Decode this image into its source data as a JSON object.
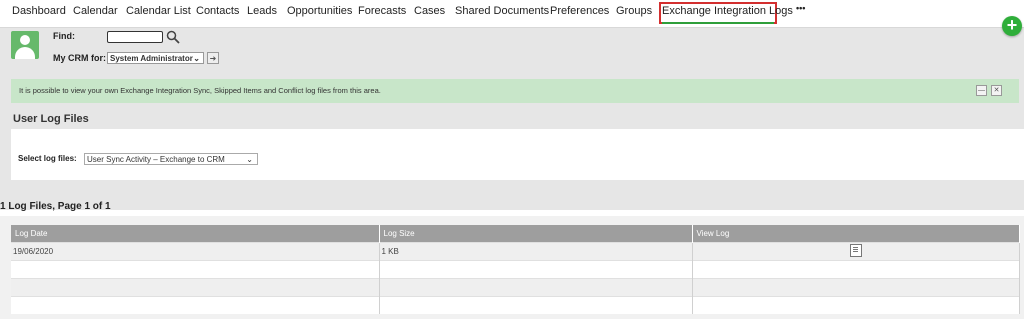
{
  "nav": {
    "tabs": [
      {
        "label": "Dashboard"
      },
      {
        "label": "Calendar"
      },
      {
        "label": "Calendar List"
      },
      {
        "label": "Contacts"
      },
      {
        "label": "Leads"
      },
      {
        "label": "Opportunities"
      },
      {
        "label": "Forecasts"
      },
      {
        "label": "Cases"
      },
      {
        "label": "Shared Documents"
      },
      {
        "label": "Preferences"
      },
      {
        "label": "Groups"
      },
      {
        "label": "Exchange Integration Logs"
      }
    ],
    "more": "•••",
    "active_tab": "Exchange Integration Logs",
    "add_label": "+"
  },
  "header": {
    "find_label": "Find:",
    "find_value": "",
    "crm_label": "My CRM for:",
    "crm_value": "System Administrator",
    "go_icon": "arrow-right-icon",
    "search_icon": "search-icon",
    "avatar_icon": "user-icon"
  },
  "banner": {
    "text": "It is possible to view your own Exchange Integration Sync, Skipped Items and Conflict log files from this area.",
    "color": "#c8e6c9"
  },
  "user_log_files": {
    "title": "User Log Files",
    "select_label": "Select log files:",
    "select_value": "User Sync Activity – Exchange to CRM"
  },
  "results": {
    "page_info": "1 Log Files, Page 1 of 1",
    "columns": [
      "Log Date",
      "Log Size",
      "View Log"
    ],
    "rows": [
      {
        "date": "19/06/2020",
        "size": "1 KB",
        "view_icon": "view-log-icon"
      }
    ]
  },
  "colors": {
    "accent_green": "#2fae3a",
    "highlight_red": "#d32f2f",
    "table_header": "#9e9e9e"
  }
}
